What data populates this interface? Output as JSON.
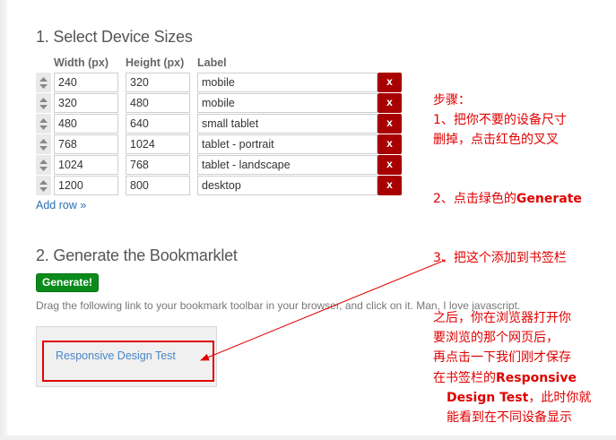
{
  "section1": {
    "title": "1. Select Device Sizes"
  },
  "table": {
    "headers": {
      "width": "Width (px)",
      "height": "Height (px)",
      "label": "Label"
    },
    "rows": [
      {
        "width": "240",
        "height": "320",
        "label": "mobile",
        "delete": "x"
      },
      {
        "width": "320",
        "height": "480",
        "label": "mobile",
        "delete": "x"
      },
      {
        "width": "480",
        "height": "640",
        "label": "small tablet",
        "delete": "x"
      },
      {
        "width": "768",
        "height": "1024",
        "label": "tablet - portrait",
        "delete": "x"
      },
      {
        "width": "1024",
        "height": "768",
        "label": "tablet - landscape",
        "delete": "x"
      },
      {
        "width": "1200",
        "height": "800",
        "label": "desktop",
        "delete": "x"
      }
    ],
    "add_row": "Add row »"
  },
  "section2": {
    "title": "2. Generate the Bookmarklet",
    "generate_button": "Generate!",
    "instructions": "Drag the following link to your bookmark toolbar in your browser, and click on it. Man, I love javascript.",
    "bookmarklet_link": "Responsive Design Test"
  },
  "annotations": {
    "heading": "步骤：",
    "step1_line1": "1、把你不要的设备尺寸",
    "step1_line2": "删掉，点击红色的叉叉",
    "step2_prefix": "2、点击绿色的",
    "step2_bold": "Generate",
    "step3": "3、把这个添加到书签栏",
    "after_line1": "之后，你在浏览器打开你",
    "after_line2": "要浏览的那个网页后，",
    "after_line3": "再点击一下我们刚才保存",
    "after_line4_prefix": "在书签栏的",
    "after_line4_bold": "Responsive",
    "after_line5_bold": "Design Test",
    "after_line5_suffix": "，此时你就",
    "after_line6": "能看到在不同设备显示"
  },
  "colors": {
    "delete_button": "#a80000",
    "generate_button": "#0a8a1a",
    "link": "#2a6db5",
    "annotation": "#e00000"
  },
  "icons": {
    "drag": "up-down-arrows-icon"
  }
}
